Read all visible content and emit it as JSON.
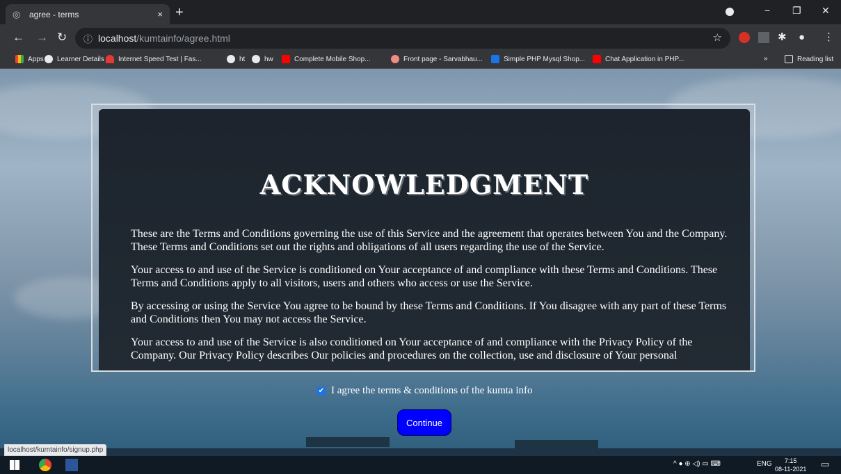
{
  "tab": {
    "title": "agree - terms",
    "close": "×",
    "new": "+"
  },
  "window": {
    "minimize": "−",
    "restore": "❐",
    "close": "✕"
  },
  "address": {
    "host": "localhost",
    "path": "/kumtainfo/agree.html"
  },
  "bookmarks": [
    {
      "label": "Apps",
      "icon_color": "#ea4335"
    },
    {
      "label": "Learner Details",
      "icon_color": "#e8eaed"
    },
    {
      "label": "Internet Speed Test | Fas...",
      "icon_color": "#e53935"
    },
    {
      "label": "ht",
      "icon_color": "#e8eaed"
    },
    {
      "label": "hw",
      "icon_color": "#e8eaed"
    },
    {
      "label": "Complete Mobile Shop...",
      "icon_color": "#ff0000"
    },
    {
      "label": "Front page - Sarvabhau...",
      "icon_color": "#f28b82"
    },
    {
      "label": "Simple PHP Mysql Shop...",
      "icon_color": "#1a73e8"
    },
    {
      "label": "Chat Application in PHP...",
      "icon_color": "#ff0000"
    }
  ],
  "bookmarks_more": "»",
  "reading_list": "Reading list",
  "page": {
    "heading": "ACKNOWLEDGMENT",
    "paragraphs": [
      "These are the Terms and Conditions governing the use of this Service and the agreement that operates between You and the Company. These Terms and Conditions set out the rights and obligations of all users regarding the use of the Service.",
      "Your access to and use of the Service is conditioned on Your acceptance of and compliance with these Terms and Conditions. These Terms and Conditions apply to all visitors, users and others who access or use the Service.",
      "By accessing or using the Service You agree to be bound by these Terms and Conditions. If You disagree with any part of these Terms and Conditions then You may not access the Service.",
      "Your access to and use of the Service is also conditioned on Your acceptance of and compliance with the Privacy Policy of the Company. Our Privacy Policy describes Our policies and procedures on the collection, use and disclosure of Your personal"
    ],
    "agree_label": "I agree the terms & conditions of the kumta info",
    "agree_checked": true,
    "continue_label": "Continue"
  },
  "status_url": "localhost/kumtainfo/signup.php",
  "taskbar": {
    "lang": "ENG",
    "time": "7:15",
    "date": "08-11-2021"
  }
}
